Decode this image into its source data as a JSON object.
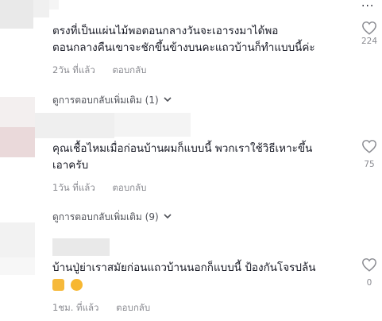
{
  "comments": [
    {
      "line1": "ตรงที่เป็นแผ่นไม้พอตอนกลางวันจะเอารงมาได้พอ",
      "line2": "ตอนกลางคืนเขาจะชักขึ้นข้างบนคะแถวบ้านก็ทำแบบนี้ค่ะ",
      "time": "2วัน ที่แล้ว",
      "reply": "ตอบกลับ",
      "likes": "224",
      "more": "ดูการตอบกลับเพิ่มเติม (1)"
    },
    {
      "line1": "คุณเชื้อไหมเมื่อก่อนบ้านผมก็แบบนี้ พวกเราใช้วิธีเหาะขึ้น",
      "line2": "เอาครับ",
      "time": "1วัน ที่แล้ว",
      "reply": "ตอบกลับ",
      "likes": "75",
      "more": "ดูการตอบกลับเพิ่มเติม (9)"
    },
    {
      "line1": "บ้านปู่ย่าเราสมัยก่อนแถวบ้านนอกก็แบบนี้ ป้องกันโจรปล้น",
      "emojis": [
        "thumbs-up",
        "heart-eyes"
      ],
      "time": "1ชม. ที่แล้ว",
      "reply": "ตอบกลับ",
      "likes": "0"
    }
  ],
  "top_menu": "...",
  "icons": {
    "like": "heart-outline-icon",
    "expand": "chevron-down-icon"
  },
  "colors": {
    "text": "#161823",
    "secondary": "#8a8b91",
    "like_outline": "#8a8b91"
  }
}
